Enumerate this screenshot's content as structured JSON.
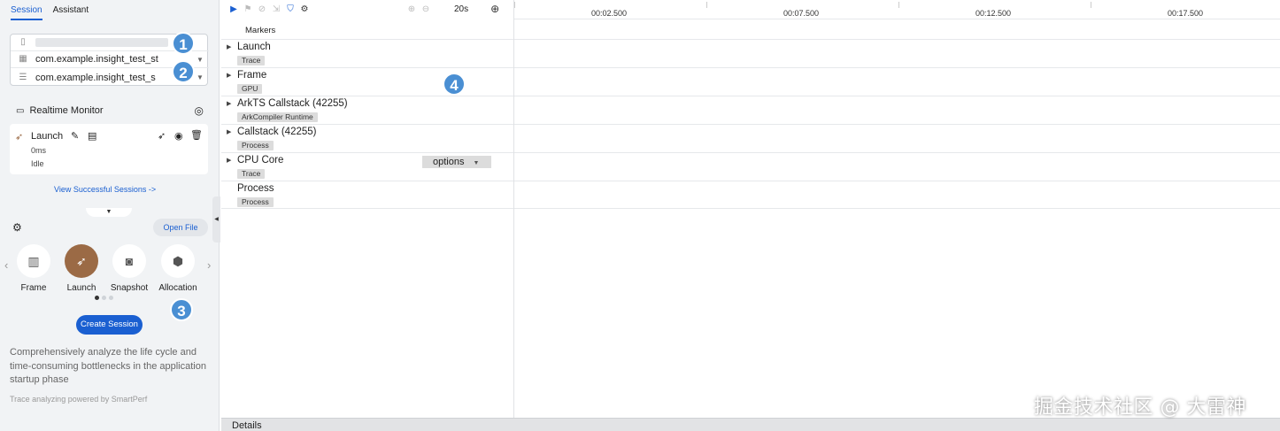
{
  "tabs": [
    "Session",
    "Assistant"
  ],
  "device": {
    "rows": [
      {
        "icon": "phone-icon",
        "text": ""
      },
      {
        "icon": "app-grid-icon",
        "text": "com.example.insight_test_st"
      },
      {
        "icon": "process-list-icon",
        "text": "com.example.insight_test_s"
      }
    ]
  },
  "badges": [
    "1",
    "2",
    "3",
    "4"
  ],
  "realtime": {
    "label": "Realtime Monitor"
  },
  "session_card": {
    "name": "Launch",
    "time": "0ms",
    "status": "Idle"
  },
  "view_link": "View Successful Sessions ->",
  "open_file": "Open File",
  "tools": [
    {
      "label": "Frame",
      "icon": "frame-icon"
    },
    {
      "label": "Launch",
      "icon": "rocket-icon"
    },
    {
      "label": "Snapshot",
      "icon": "camera-icon"
    },
    {
      "label": "Allocation",
      "icon": "cube-icon"
    }
  ],
  "create_button": "Create Session",
  "description": "Comprehensively analyze the life cycle and time-consuming bottlenecks in the application startup phase",
  "powered_by": "Trace analyzing powered by SmartPerf",
  "toolbar": {
    "duration": "20s"
  },
  "timeline": {
    "ticks": [
      "00:02.500",
      "00:07.500",
      "00:12.500",
      "00:17.500"
    ]
  },
  "markers_label": "Markers",
  "lanes": [
    {
      "title": "Launch",
      "tag": "Trace",
      "expandable": true
    },
    {
      "title": "Frame",
      "tag": "GPU",
      "expandable": true
    },
    {
      "title": "ArkTS Callstack (42255)",
      "tag": "ArkCompiler Runtime",
      "expandable": true
    },
    {
      "title": "Callstack (42255)",
      "tag": "Process",
      "expandable": true
    },
    {
      "title": "CPU Core",
      "tag": "Trace",
      "expandable": true
    },
    {
      "title": "Process",
      "tag": "Process",
      "expandable": false
    }
  ],
  "options_label": "options",
  "details_label": "Details",
  "watermark": "掘金技术社区 @ 大雷神",
  "colors": {
    "accent": "#1a5fd1",
    "badge": "#4a8fd3",
    "launch_selected": "#9b6a45"
  }
}
